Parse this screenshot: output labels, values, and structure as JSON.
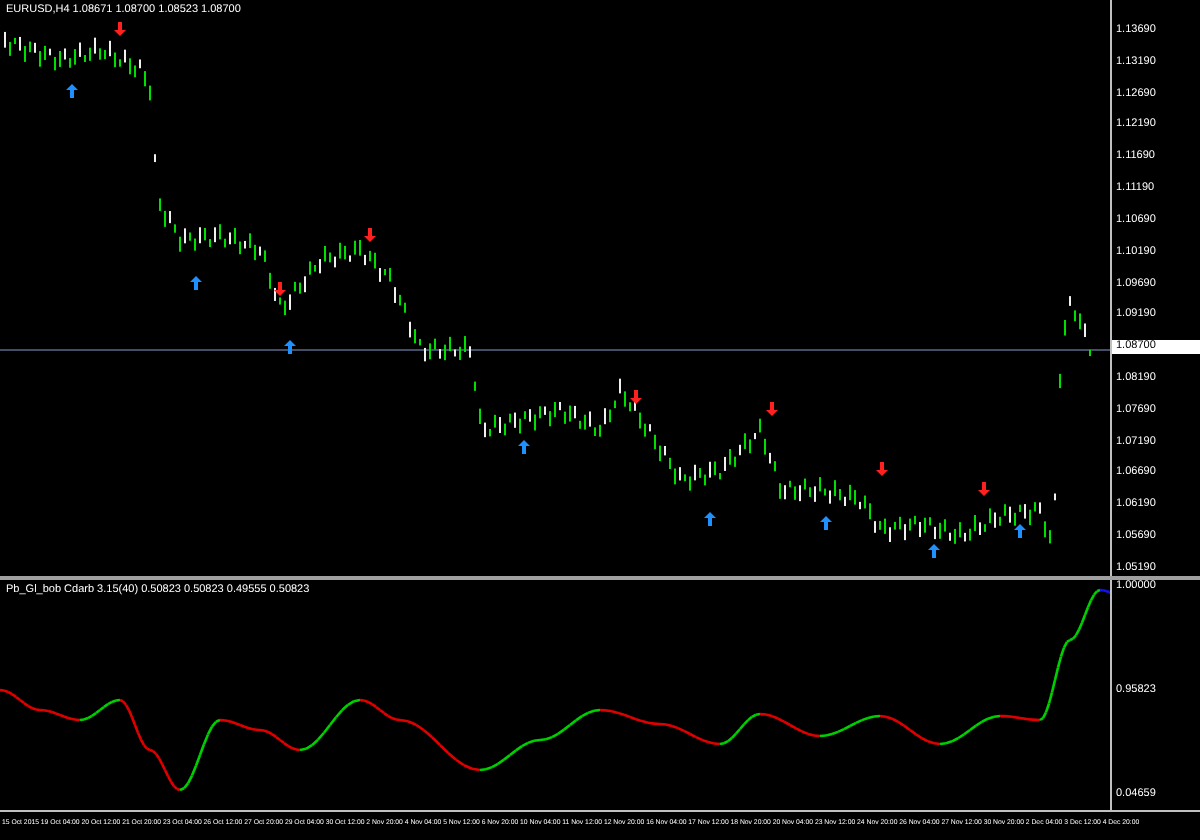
{
  "main_chart": {
    "title": "EURUSD,H4  1.08671 1.08700 1.08523 1.08700",
    "price_axis": [
      {
        "label": "1.13690",
        "selected": false
      },
      {
        "label": "1.13190",
        "selected": false
      },
      {
        "label": "1.12690",
        "selected": false
      },
      {
        "label": "1.12190",
        "selected": false
      },
      {
        "label": "1.11690",
        "selected": false
      },
      {
        "label": "1.11190",
        "selected": false
      },
      {
        "label": "1.10690",
        "selected": false
      },
      {
        "label": "1.10190",
        "selected": false
      },
      {
        "label": "1.09690",
        "selected": false
      },
      {
        "label": "1.09190",
        "selected": false
      },
      {
        "label": "1.08700",
        "selected": true
      },
      {
        "label": "1.08190",
        "selected": false
      },
      {
        "label": "1.07690",
        "selected": false
      },
      {
        "label": "1.07190",
        "selected": false
      },
      {
        "label": "1.06690",
        "selected": false
      },
      {
        "label": "1.06190",
        "selected": false
      },
      {
        "label": "1.05690",
        "selected": false
      },
      {
        "label": "1.05190",
        "selected": false
      }
    ]
  },
  "indicator": {
    "title": "Pb_Gl_bob Cdarb 3.15(40) 0.50823 0.50823 0.49555 0.50823",
    "axis": [
      "1.00000",
      "0.95823",
      "0.04659"
    ]
  },
  "time_axis": [
    "15 Oct 2015",
    "19 Oct 04:00",
    "20 Oct 12:00",
    "21 Oct 20:00",
    "23 Oct 04:00",
    "26 Oct 12:00",
    "27 Oct 20:00",
    "29 Oct 04:00",
    "30 Oct 12:00",
    "2 Nov 20:00",
    "4 Nov 04:00",
    "5 Nov 12:00",
    "6 Nov 20:00",
    "10 Nov 04:00",
    "11 Nov 12:00",
    "12 Nov 20:00",
    "16 Nov 04:00",
    "17 Nov 12:00",
    "18 Nov 20:00",
    "20 Nov 04:00",
    "23 Nov 12:00",
    "24 Nov 20:00",
    "26 Nov 04:00",
    "27 Nov 12:00",
    "30 Nov 20:00",
    "2 Dec 04:00",
    "3 Dec 12:00",
    "4 Dec 20:00"
  ]
}
